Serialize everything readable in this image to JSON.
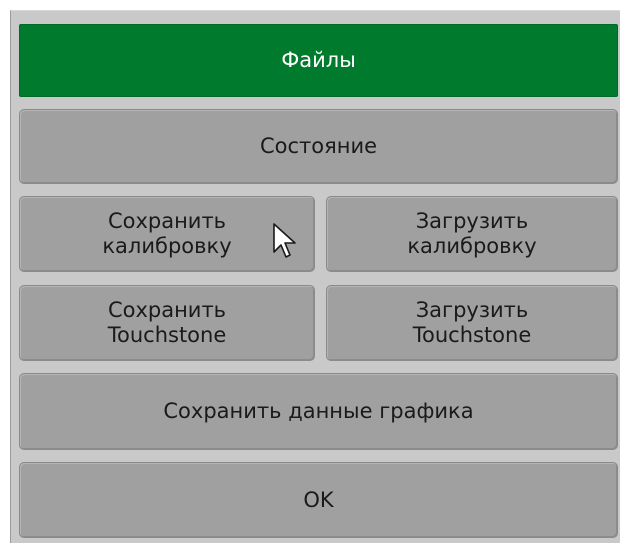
{
  "menu": {
    "files_label": "Файлы",
    "state_label": "Состояние",
    "save_calibration_label": "Сохранить\nкалибровку",
    "load_calibration_label": "Загрузить\nкалибровку",
    "save_touchstone_label": "Сохранить\nTouchstone",
    "load_touchstone_label": "Загрузить\nTouchstone",
    "save_chart_data_label": "Сохранить данные графика",
    "ok_label": "OK"
  },
  "colors": {
    "active_button": "#007a2c",
    "button": "#a0a0a0",
    "panel": "#c9c9c9"
  },
  "icons": {
    "cursor": "mouse-pointer-icon"
  }
}
